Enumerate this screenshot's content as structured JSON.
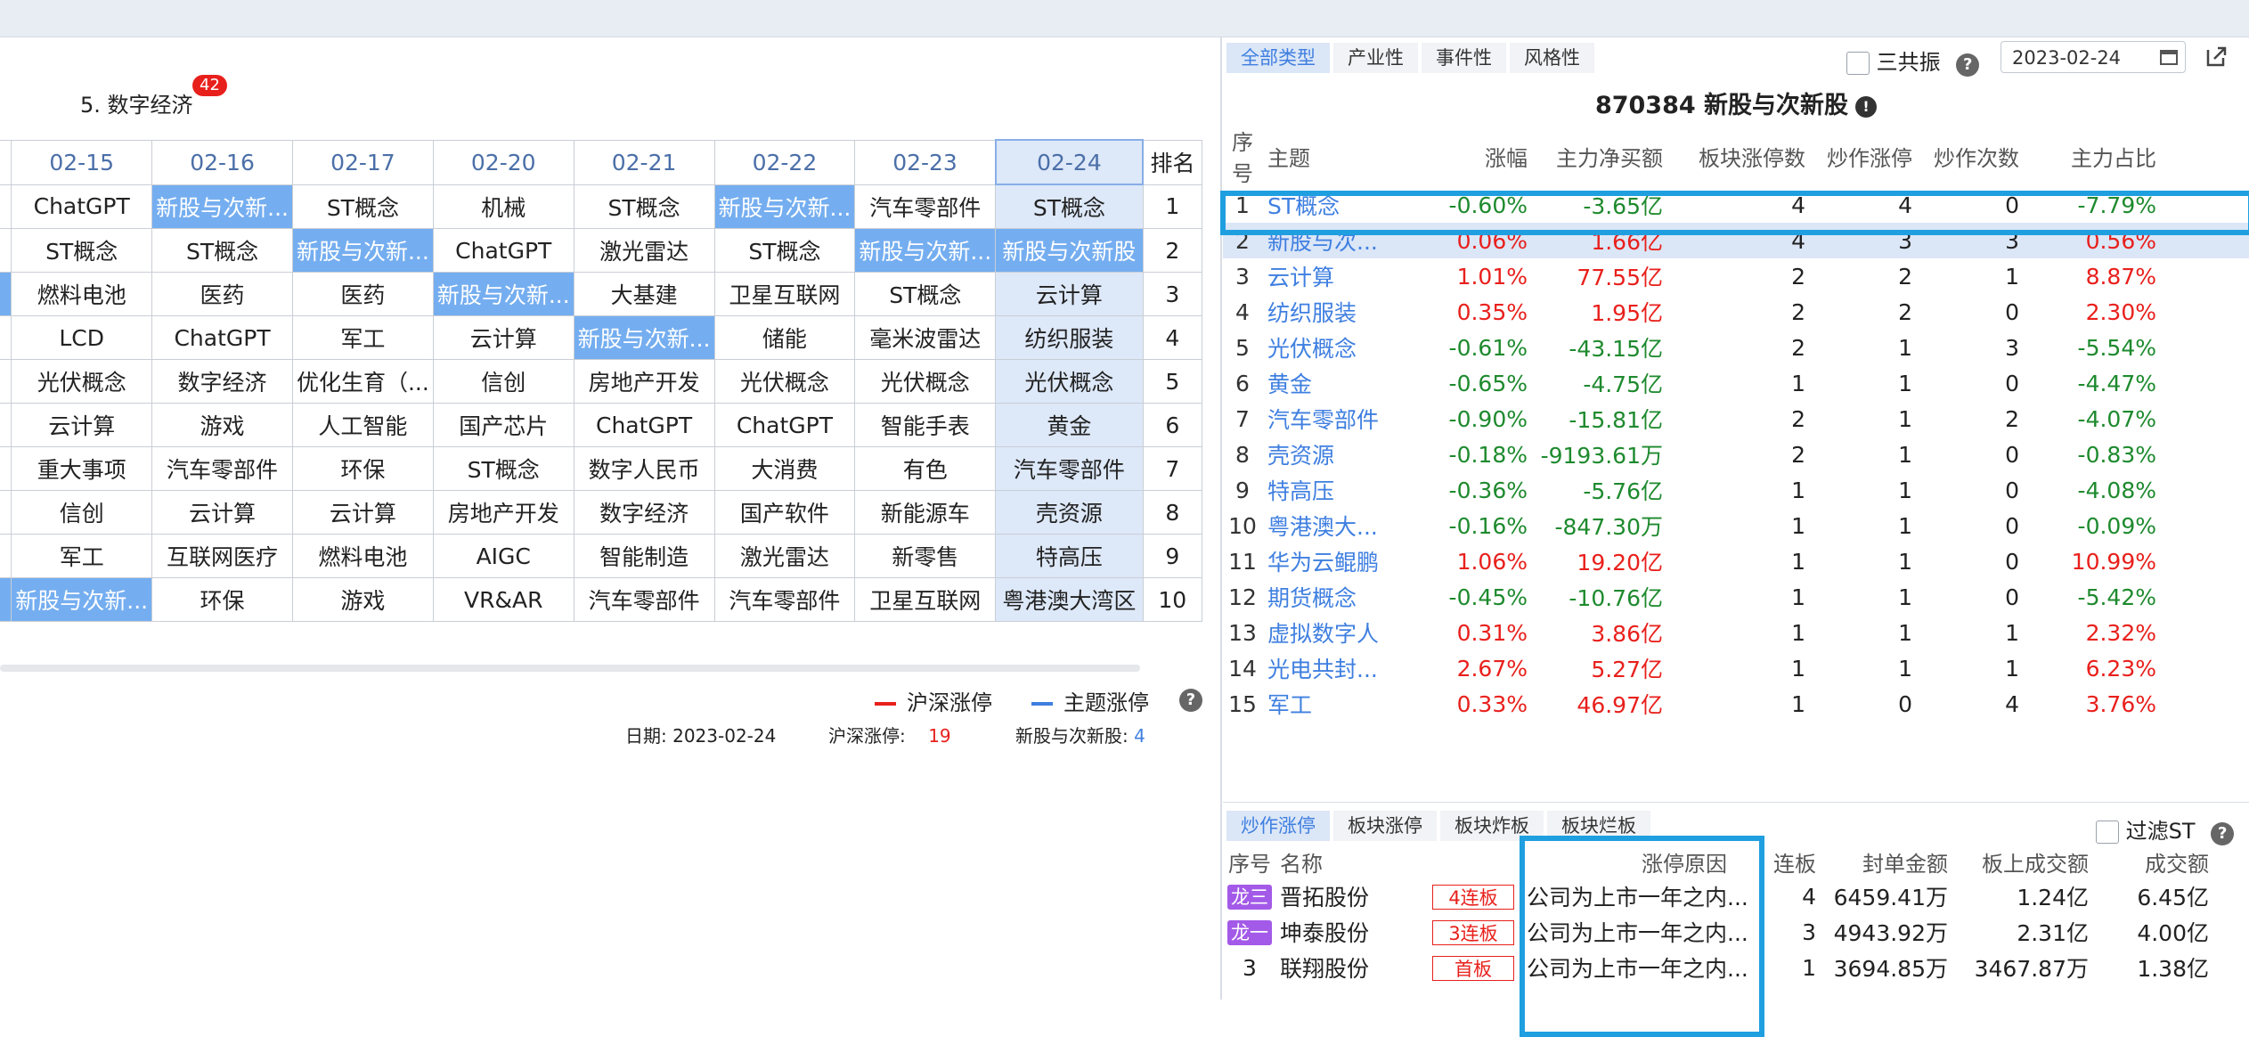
{
  "left": {
    "section_title": "5. 数字经济",
    "section_badge": "42",
    "grid_dates": [
      "02-15",
      "02-16",
      "02-17",
      "02-20",
      "02-21",
      "02-22",
      "02-23",
      "02-24"
    ],
    "grid_rank_header": "排名",
    "grid_rows": [
      {
        "rank": "1",
        "prev": "",
        "cells": [
          "ChatGPT",
          "新股与次新...",
          "ST概念",
          "机械",
          "ST概念",
          "新股与次新...",
          "汽车零部件",
          "ST概念"
        ]
      },
      {
        "rank": "2",
        "prev": "",
        "cells": [
          "ST概念",
          "ST概念",
          "新股与次新...",
          "ChatGPT",
          "激光雷达",
          "ST概念",
          "新股与次新...",
          "新股与次新股"
        ]
      },
      {
        "rank": "3",
        "prev": ".",
        "cells": [
          "燃料电池",
          "医药",
          "医药",
          "新股与次新...",
          "大基建",
          "卫星互联网",
          "ST概念",
          "云计算"
        ]
      },
      {
        "rank": "4",
        "prev": "",
        "cells": [
          "LCD",
          "ChatGPT",
          "军工",
          "云计算",
          "新股与次新...",
          "储能",
          "毫米波雷达",
          "纺织服装"
        ]
      },
      {
        "rank": "5",
        "prev": "",
        "cells": [
          "光伏概念",
          "数字经济",
          "优化生育（...",
          "信创",
          "房地产开发",
          "光伏概念",
          "光伏概念",
          "光伏概念"
        ]
      },
      {
        "rank": "6",
        "prev": "",
        "cells": [
          "云计算",
          "游戏",
          "人工智能",
          "国产芯片",
          "ChatGPT",
          "ChatGPT",
          "智能手表",
          "黄金"
        ]
      },
      {
        "rank": "7",
        "prev": ".",
        "cells": [
          "重大事项",
          "汽车零部件",
          "环保",
          "ST概念",
          "数字人民币",
          "大消费",
          "有色",
          "汽车零部件"
        ]
      },
      {
        "rank": "8",
        "prev": "",
        "cells": [
          "信创",
          "云计算",
          "云计算",
          "房地产开发",
          "数字经济",
          "国产软件",
          "新能源车",
          "壳资源"
        ]
      },
      {
        "rank": "9",
        "prev": "",
        "cells": [
          "军工",
          "互联网医疗",
          "燃料电池",
          "AIGC",
          "智能制造",
          "激光雷达",
          "新零售",
          "特高压"
        ]
      },
      {
        "rank": "10",
        "prev": ".",
        "cells": [
          "新股与次新...",
          "环保",
          "游戏",
          "VR&AR",
          "汽车零部件",
          "汽车零部件",
          "卫星互联网",
          "粤港澳大湾区"
        ]
      }
    ],
    "legend_market": "沪深涨停",
    "legend_theme": "主题涨停",
    "info_date_label": "日期:",
    "info_date": "2023-02-24",
    "info_market_label": "沪深涨停:",
    "info_market_value": "19",
    "info_theme_label": "新股与次新股:",
    "info_theme_value": "4",
    "colors": {
      "market_line": "#e8201c",
      "theme_line": "#3f7fe0",
      "highlight": "#75aef0"
    }
  },
  "right": {
    "tabs": [
      "全部类型",
      "产业性",
      "事件性",
      "风格性"
    ],
    "resonance_label": "三共振",
    "date_value": "2023-02-24",
    "title": "870384 新股与次新股",
    "theme_headers": [
      "序号",
      "主题",
      "涨幅",
      "主力净买额",
      "板块涨停数",
      "炒作涨停",
      "炒作次数",
      "主力占比"
    ],
    "themes": [
      {
        "idx": "1",
        "name": "ST概念",
        "chg": "-0.60%",
        "net": "-3.65亿",
        "limit": "4",
        "hype": "4",
        "times": "0",
        "ratio": "-7.79%",
        "dir": "dn",
        "ratio_dir": "dn"
      },
      {
        "idx": "2",
        "name": "新股与次...",
        "chg": "0.06%",
        "net": "1.66亿",
        "limit": "4",
        "hype": "3",
        "times": "3",
        "ratio": "0.56%",
        "dir": "up",
        "ratio_dir": "up"
      },
      {
        "idx": "3",
        "name": "云计算",
        "chg": "1.01%",
        "net": "77.55亿",
        "limit": "2",
        "hype": "2",
        "times": "1",
        "ratio": "8.87%",
        "dir": "up",
        "ratio_dir": "up"
      },
      {
        "idx": "4",
        "name": "纺织服装",
        "chg": "0.35%",
        "net": "1.95亿",
        "limit": "2",
        "hype": "2",
        "times": "0",
        "ratio": "2.30%",
        "dir": "up",
        "ratio_dir": "up"
      },
      {
        "idx": "5",
        "name": "光伏概念",
        "chg": "-0.61%",
        "net": "-43.15亿",
        "limit": "2",
        "hype": "1",
        "times": "3",
        "ratio": "-5.54%",
        "dir": "dn",
        "ratio_dir": "dn"
      },
      {
        "idx": "6",
        "name": "黄金",
        "chg": "-0.65%",
        "net": "-4.75亿",
        "limit": "1",
        "hype": "1",
        "times": "0",
        "ratio": "-4.47%",
        "dir": "dn",
        "ratio_dir": "dn"
      },
      {
        "idx": "7",
        "name": "汽车零部件",
        "chg": "-0.90%",
        "net": "-15.81亿",
        "limit": "2",
        "hype": "1",
        "times": "2",
        "ratio": "-4.07%",
        "dir": "dn",
        "ratio_dir": "dn"
      },
      {
        "idx": "8",
        "name": "壳资源",
        "chg": "-0.18%",
        "net": "-9193.61万",
        "limit": "2",
        "hype": "1",
        "times": "0",
        "ratio": "-0.83%",
        "dir": "dn",
        "ratio_dir": "dn"
      },
      {
        "idx": "9",
        "name": "特高压",
        "chg": "-0.36%",
        "net": "-5.76亿",
        "limit": "1",
        "hype": "1",
        "times": "0",
        "ratio": "-4.08%",
        "dir": "dn",
        "ratio_dir": "dn"
      },
      {
        "idx": "10",
        "name": "粤港澳大...",
        "chg": "-0.16%",
        "net": "-847.30万",
        "limit": "1",
        "hype": "1",
        "times": "0",
        "ratio": "-0.09%",
        "dir": "dn",
        "ratio_dir": "dn"
      },
      {
        "idx": "11",
        "name": "华为云鲲鹏",
        "chg": "1.06%",
        "net": "19.20亿",
        "limit": "1",
        "hype": "1",
        "times": "0",
        "ratio": "10.99%",
        "dir": "up",
        "ratio_dir": "up"
      },
      {
        "idx": "12",
        "name": "期货概念",
        "chg": "-0.45%",
        "net": "-10.76亿",
        "limit": "1",
        "hype": "1",
        "times": "0",
        "ratio": "-5.42%",
        "dir": "dn",
        "ratio_dir": "dn"
      },
      {
        "idx": "13",
        "name": "虚拟数字人",
        "chg": "0.31%",
        "net": "3.86亿",
        "limit": "1",
        "hype": "1",
        "times": "1",
        "ratio": "2.32%",
        "dir": "up",
        "ratio_dir": "up"
      },
      {
        "idx": "14",
        "name": "光电共封...",
        "chg": "2.67%",
        "net": "5.27亿",
        "limit": "1",
        "hype": "1",
        "times": "1",
        "ratio": "6.23%",
        "dir": "up",
        "ratio_dir": "up"
      },
      {
        "idx": "15",
        "name": "军工",
        "chg": "0.33%",
        "net": "46.97亿",
        "limit": "1",
        "hype": "0",
        "times": "4",
        "ratio": "3.76%",
        "dir": "up",
        "ratio_dir": "up"
      }
    ],
    "bottom_tabs": [
      "炒作涨停",
      "板块涨停",
      "板块炸板",
      "板块烂板"
    ],
    "filter_label": "过滤ST",
    "stock_headers": [
      "序号",
      "名称",
      "涨停原因",
      "连板",
      "封单金额",
      "板上成交额",
      "成交额"
    ],
    "stocks": [
      {
        "idx": "龙三",
        "dragon": true,
        "name": "晋拓股份",
        "board": "4连板",
        "reason": "公司为上市一年之内...",
        "lb": "4",
        "seal": "6459.41万",
        "onboard": "1.24亿",
        "turnover": "6.45亿"
      },
      {
        "idx": "龙一",
        "dragon": true,
        "name": "坤泰股份",
        "board": "3连板",
        "reason": "公司为上市一年之内...",
        "lb": "3",
        "seal": "4943.92万",
        "onboard": "2.31亿",
        "turnover": "4.00亿"
      },
      {
        "idx": "3",
        "dragon": false,
        "name": "联翔股份",
        "board": "首板",
        "reason": "公司为上市一年之内...",
        "lb": "1",
        "seal": "3694.85万",
        "onboard": "3467.87万",
        "turnover": "1.38亿"
      }
    ],
    "colors": {
      "up": "#e8201c",
      "down": "#1e8a2e",
      "link": "#3f7fe0",
      "frame": "#1f9fe0",
      "dragon": "#a35ae8"
    }
  }
}
